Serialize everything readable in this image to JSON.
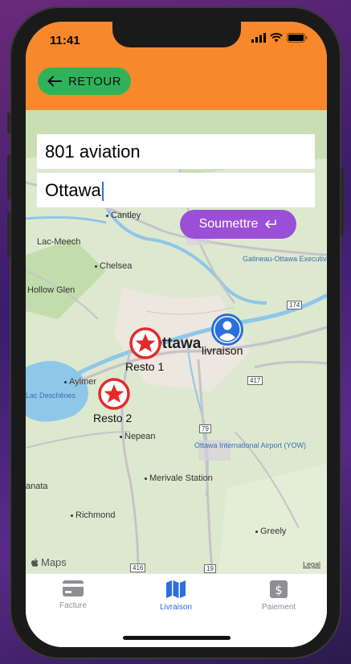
{
  "status_bar": {
    "time": "11:41"
  },
  "header": {
    "back_label": "RETOUR",
    "back_icon": "arrow-left-icon",
    "color": "#f7882b"
  },
  "form": {
    "address_value": "801 aviation",
    "city_value": "Ottawa",
    "submit_label": "Soumettre",
    "submit_icon": "return-icon",
    "submit_color": "#9b4fd6"
  },
  "map": {
    "labels": {
      "cantley": "Cantley",
      "lac_meech": "Lac-Meech",
      "chelsea": "Chelsea",
      "hollow_glen": "Hollow Glen",
      "gatineau_airport": "Gatineau-Ottawa Executive Airport (YND)",
      "ottawa": "Ottawa",
      "aylmer": "Aylmer",
      "lac_deschenes": "Lac Deschênes",
      "nepean": "Nepean",
      "ottawa_airport": "Ottawa International Airport (YOW)",
      "merivale": "Merivale Station",
      "kanata": "anata",
      "greely": "Greely",
      "richmond": "Richmond",
      "hwy_174": "174",
      "hwy_417": "417",
      "hwy_79": "79",
      "hwy_416": "416",
      "hwy_19": "19"
    },
    "markers": {
      "resto1": "Resto 1",
      "resto2": "Resto 2",
      "livraison": "livraison"
    },
    "brand": "Maps",
    "legal": "Legal"
  },
  "tabbar": {
    "tabs": [
      {
        "label": "Facture",
        "icon": "credit-card-icon",
        "active": false
      },
      {
        "label": "Livraison",
        "icon": "map-icon",
        "active": true
      },
      {
        "label": "Paiement",
        "icon": "dollar-doc-icon",
        "active": false
      }
    ],
    "active_color": "#2a6ee0"
  }
}
